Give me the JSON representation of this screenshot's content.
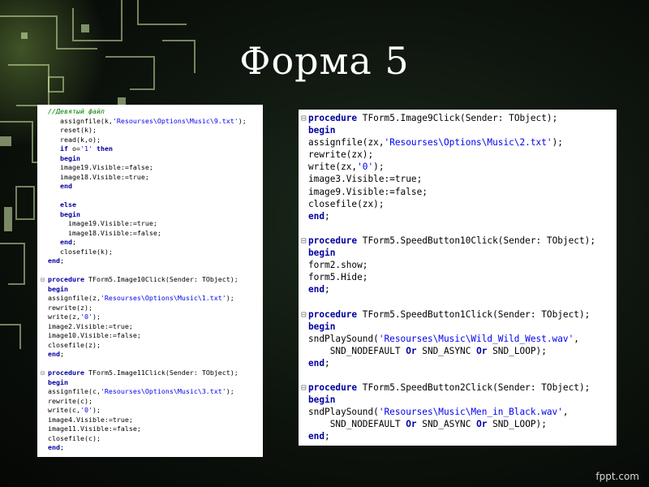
{
  "slide": {
    "title": "Форма 5",
    "credit": "fppt.com"
  },
  "left_code": [
    {
      "parts": [
        {
          "t": "//Девятый файл",
          "c": "c"
        }
      ]
    },
    {
      "parts": [
        {
          "t": "   assignfile(k,"
        },
        {
          "t": "'Resourses\\Options\\Music\\9.txt'",
          "c": "s"
        },
        {
          "t": ");"
        }
      ]
    },
    {
      "parts": [
        {
          "t": "   reset(k);"
        }
      ]
    },
    {
      "parts": [
        {
          "t": "   read(k,o);"
        }
      ]
    },
    {
      "parts": [
        {
          "t": "   "
        },
        {
          "t": "if",
          "c": "k"
        },
        {
          "t": " o="
        },
        {
          "t": "'1'",
          "c": "s"
        },
        {
          "t": " "
        },
        {
          "t": "then",
          "c": "k"
        }
      ]
    },
    {
      "parts": [
        {
          "t": "   "
        },
        {
          "t": "begin",
          "c": "k"
        }
      ]
    },
    {
      "parts": [
        {
          "t": "   image19.Visible:=false;"
        }
      ]
    },
    {
      "parts": [
        {
          "t": "   image18.Visible:=true;"
        }
      ]
    },
    {
      "parts": [
        {
          "t": "   "
        },
        {
          "t": "end",
          "c": "k"
        }
      ]
    },
    {
      "parts": []
    },
    {
      "parts": [
        {
          "t": "   "
        },
        {
          "t": "else",
          "c": "k"
        }
      ]
    },
    {
      "parts": [
        {
          "t": "   "
        },
        {
          "t": "begin",
          "c": "k"
        }
      ]
    },
    {
      "parts": [
        {
          "t": "     image19.Visible:=true;"
        }
      ]
    },
    {
      "parts": [
        {
          "t": "     image18.Visible:=false;"
        }
      ]
    },
    {
      "parts": [
        {
          "t": "   "
        },
        {
          "t": "end",
          "c": "k"
        },
        {
          "t": ";"
        }
      ]
    },
    {
      "parts": [
        {
          "t": "   closefile(k);"
        }
      ]
    },
    {
      "parts": [
        {
          "t": ""
        },
        {
          "t": "end",
          "c": "k"
        },
        {
          "t": ";"
        }
      ]
    },
    {
      "parts": []
    },
    {
      "fold": true,
      "parts": [
        {
          "t": "procedure",
          "c": "k"
        },
        {
          "t": " TForm5.Image10Click(Sender: TObject);"
        }
      ]
    },
    {
      "parts": [
        {
          "t": "begin",
          "c": "k"
        }
      ]
    },
    {
      "parts": [
        {
          "t": "assignfile(z,"
        },
        {
          "t": "'Resourses\\Options\\Music\\1.txt'",
          "c": "s"
        },
        {
          "t": ");"
        }
      ]
    },
    {
      "parts": [
        {
          "t": "rewrite(z);"
        }
      ]
    },
    {
      "parts": [
        {
          "t": "write(z,"
        },
        {
          "t": "'0'",
          "c": "s"
        },
        {
          "t": ");"
        }
      ]
    },
    {
      "parts": [
        {
          "t": "image2.Visible:=true;"
        }
      ]
    },
    {
      "parts": [
        {
          "t": "image10.Visible:=false;"
        }
      ]
    },
    {
      "parts": [
        {
          "t": "closefile(z);"
        }
      ]
    },
    {
      "parts": [
        {
          "t": "end",
          "c": "k"
        },
        {
          "t": ";"
        }
      ]
    },
    {
      "parts": []
    },
    {
      "fold": true,
      "parts": [
        {
          "t": "procedure",
          "c": "k"
        },
        {
          "t": " TForm5.Image11Click(Sender: TObject);"
        }
      ]
    },
    {
      "parts": [
        {
          "t": "begin",
          "c": "k"
        }
      ]
    },
    {
      "parts": [
        {
          "t": "assignfile(c,"
        },
        {
          "t": "'Resourses\\Options\\Music\\3.txt'",
          "c": "s"
        },
        {
          "t": ");"
        }
      ]
    },
    {
      "parts": [
        {
          "t": "rewrite(c);"
        }
      ]
    },
    {
      "parts": [
        {
          "t": "write(c,"
        },
        {
          "t": "'0'",
          "c": "s"
        },
        {
          "t": ");"
        }
      ]
    },
    {
      "parts": [
        {
          "t": "image4.Visible:=true;"
        }
      ]
    },
    {
      "parts": [
        {
          "t": "image11.Visible:=false;"
        }
      ]
    },
    {
      "parts": [
        {
          "t": "closefile(c);"
        }
      ]
    },
    {
      "parts": [
        {
          "t": "end",
          "c": "k"
        },
        {
          "t": ";"
        }
      ]
    }
  ],
  "right_code": [
    {
      "fold": true,
      "parts": [
        {
          "t": "procedure",
          "c": "k"
        },
        {
          "t": " TForm5.Image9Click(Sender: TObject);"
        }
      ]
    },
    {
      "parts": [
        {
          "t": "begin",
          "c": "k"
        }
      ]
    },
    {
      "parts": [
        {
          "t": "assignfile(zx,"
        },
        {
          "t": "'Resourses\\Options\\Music\\2.txt'",
          "c": "s"
        },
        {
          "t": ");"
        }
      ]
    },
    {
      "parts": [
        {
          "t": "rewrite(zx);"
        }
      ]
    },
    {
      "parts": [
        {
          "t": "write(zx,"
        },
        {
          "t": "'0'",
          "c": "s"
        },
        {
          "t": ");"
        }
      ]
    },
    {
      "parts": [
        {
          "t": "image3.Visible:=true;"
        }
      ]
    },
    {
      "parts": [
        {
          "t": "image9.Visible:=false;"
        }
      ]
    },
    {
      "parts": [
        {
          "t": "closefile(zx);"
        }
      ]
    },
    {
      "parts": [
        {
          "t": "end",
          "c": "k"
        },
        {
          "t": ";"
        }
      ]
    },
    {
      "parts": []
    },
    {
      "fold": true,
      "parts": [
        {
          "t": "procedure",
          "c": "k"
        },
        {
          "t": " TForm5.SpeedButton10Click(Sender: TObject);"
        }
      ]
    },
    {
      "parts": [
        {
          "t": "begin",
          "c": "k"
        }
      ]
    },
    {
      "parts": [
        {
          "t": "form2.show;"
        }
      ]
    },
    {
      "parts": [
        {
          "t": "form5.Hide;"
        }
      ]
    },
    {
      "parts": [
        {
          "t": "end",
          "c": "k"
        },
        {
          "t": ";"
        }
      ]
    },
    {
      "parts": []
    },
    {
      "fold": true,
      "parts": [
        {
          "t": "procedure",
          "c": "k"
        },
        {
          "t": " TForm5.SpeedButton1Click(Sender: TObject);"
        }
      ]
    },
    {
      "parts": [
        {
          "t": "begin",
          "c": "k"
        }
      ]
    },
    {
      "parts": [
        {
          "t": "sndPlaySound("
        },
        {
          "t": "'Resourses\\Music\\Wild_Wild_West.wav'",
          "c": "s"
        },
        {
          "t": ","
        }
      ]
    },
    {
      "parts": [
        {
          "t": "    SND_NODEFAULT "
        },
        {
          "t": "Or",
          "c": "k"
        },
        {
          "t": " SND_ASYNC "
        },
        {
          "t": "Or",
          "c": "k"
        },
        {
          "t": " SND_LOOP);"
        }
      ]
    },
    {
      "parts": [
        {
          "t": "end",
          "c": "k"
        },
        {
          "t": ";"
        }
      ]
    },
    {
      "parts": []
    },
    {
      "fold": true,
      "parts": [
        {
          "t": "procedure",
          "c": "k"
        },
        {
          "t": " TForm5.SpeedButton2Click(Sender: TObject);"
        }
      ]
    },
    {
      "parts": [
        {
          "t": "begin",
          "c": "k"
        }
      ]
    },
    {
      "parts": [
        {
          "t": "sndPlaySound("
        },
        {
          "t": "'Resourses\\Music\\Men_in_Black.wav'",
          "c": "s"
        },
        {
          "t": ","
        }
      ]
    },
    {
      "parts": [
        {
          "t": "    SND_NODEFAULT "
        },
        {
          "t": "Or",
          "c": "k"
        },
        {
          "t": " SND_ASYNC "
        },
        {
          "t": "Or",
          "c": "k"
        },
        {
          "t": " SND_LOOP);"
        }
      ]
    },
    {
      "parts": [
        {
          "t": "end",
          "c": "k"
        },
        {
          "t": ";"
        }
      ]
    }
  ]
}
